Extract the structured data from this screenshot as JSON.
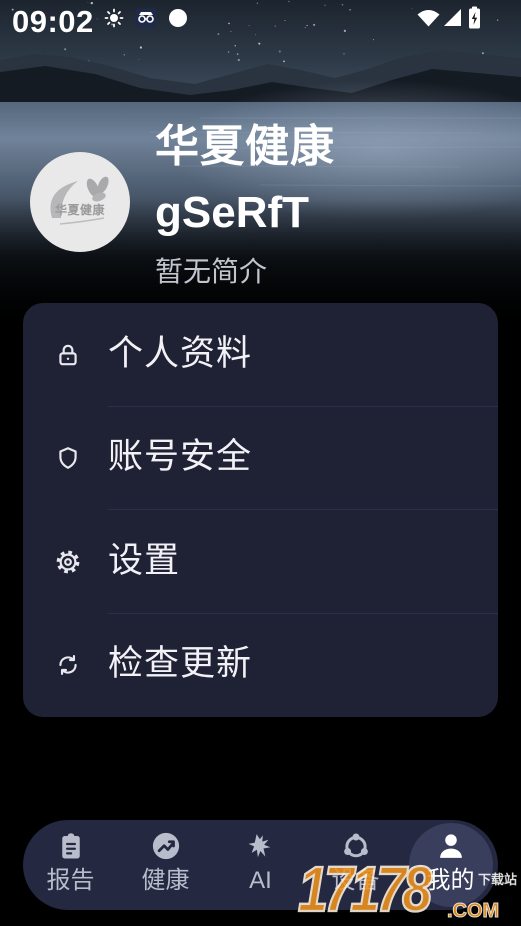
{
  "status_bar": {
    "time": "09:02",
    "left_icons": [
      "sun-icon",
      "incognito-icon",
      "circle-icon"
    ],
    "right_icons": [
      "wifi-icon",
      "signal-icon",
      "battery-charging-icon"
    ]
  },
  "profile": {
    "avatar_logo_text": "华夏健康",
    "name": "华夏健康",
    "username": "gSeRfT",
    "bio": "暂无简介"
  },
  "menu": {
    "items": [
      {
        "label": "个人资料",
        "icon": "lock-icon"
      },
      {
        "label": "账号安全",
        "icon": "shield-icon"
      },
      {
        "label": "设置",
        "icon": "gear-icon"
      },
      {
        "label": "检查更新",
        "icon": "refresh-icon"
      }
    ]
  },
  "bottom_nav": {
    "items": [
      {
        "label": "报告",
        "icon": "clipboard-icon",
        "selected": false
      },
      {
        "label": "健康",
        "icon": "health-trend-icon",
        "selected": false
      },
      {
        "label": "AI",
        "icon": "ai-icon",
        "selected": false
      },
      {
        "label": "设备",
        "icon": "device-icon",
        "selected": false
      },
      {
        "label": "我的",
        "icon": "person-icon",
        "selected": true
      }
    ]
  },
  "watermark": {
    "number": "17178",
    "site": "下载站",
    "domain": ".COM"
  },
  "colors": {
    "page_bg": "#000000",
    "card_bg": "#1f2135",
    "divider": "#2c2f47",
    "nav_bg": "#242841",
    "nav_selected_bg": "#3a3e5d",
    "text_primary": "#f2f2f6",
    "text_secondary": "#c3c5ce",
    "nav_label": "#b9bccb",
    "nav_label_active": "#ffffff",
    "avatar_bg": "#e9e9ea",
    "watermark_orange": "#f0921c"
  }
}
